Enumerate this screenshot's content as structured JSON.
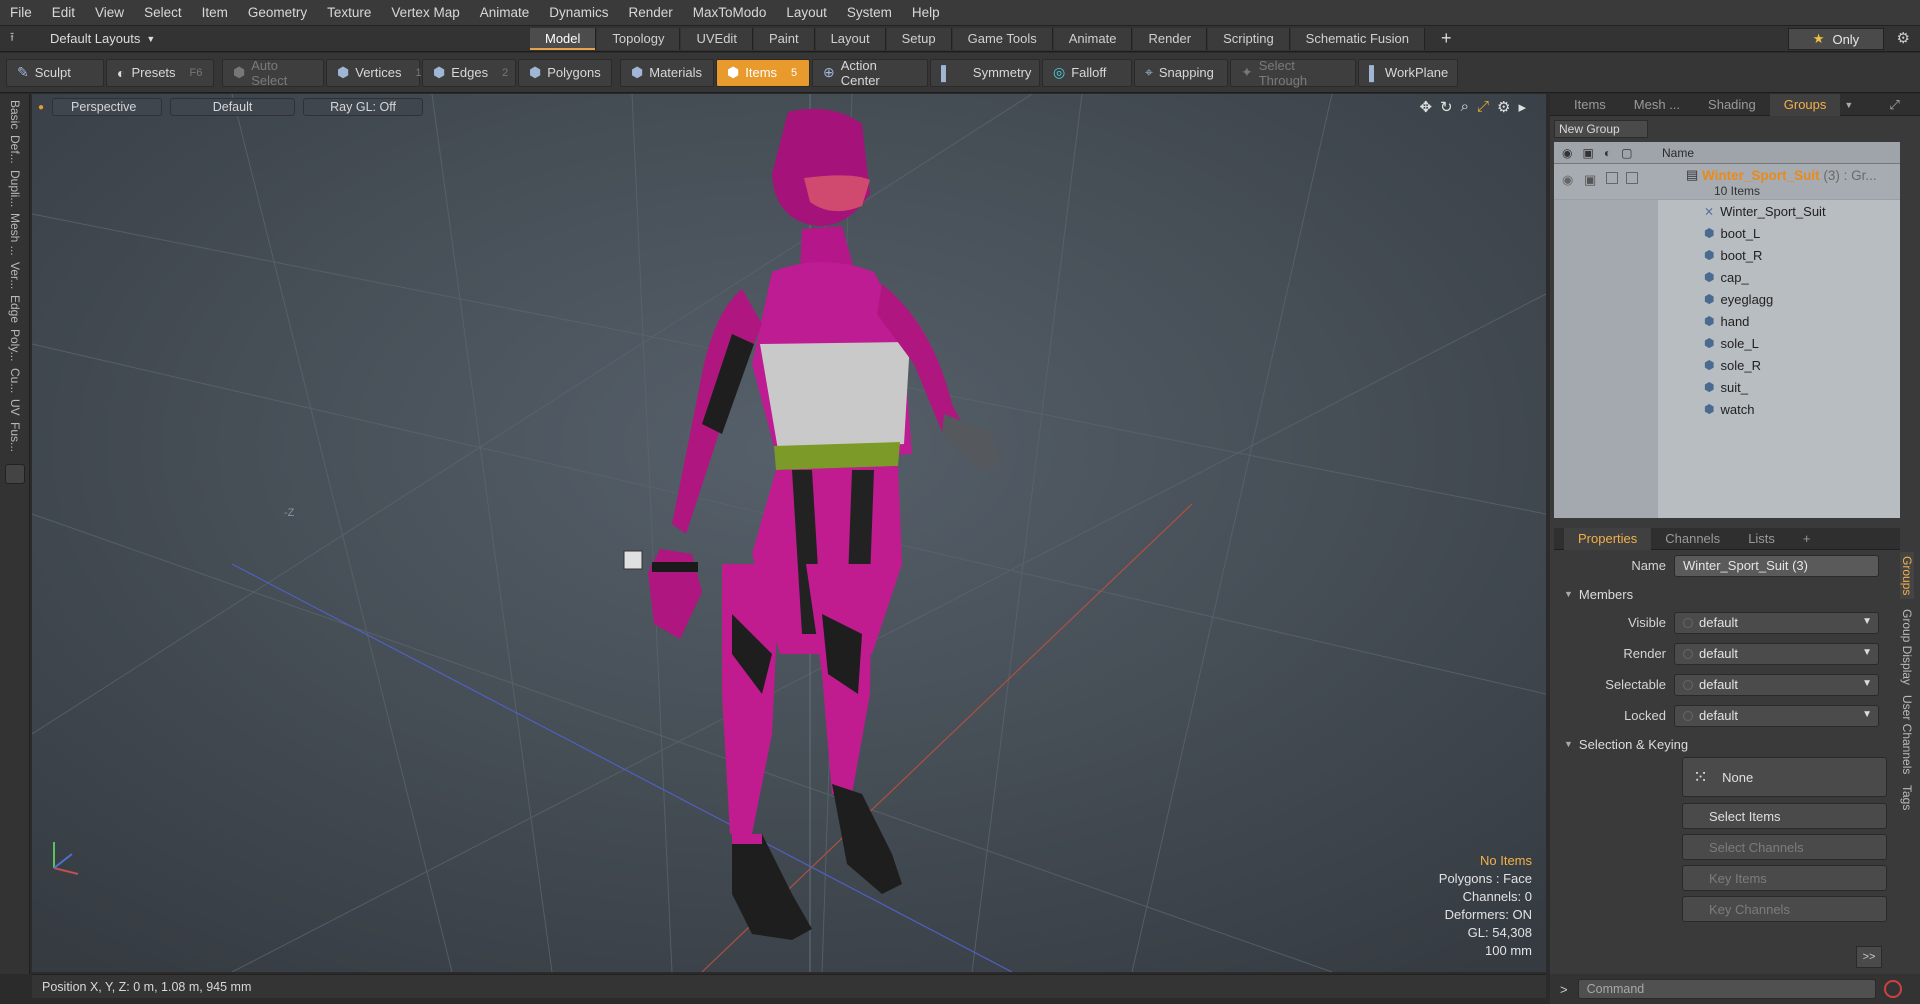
{
  "menu": [
    "File",
    "Edit",
    "View",
    "Select",
    "Item",
    "Geometry",
    "Texture",
    "Vertex Map",
    "Animate",
    "Dynamics",
    "Render",
    "MaxToModo",
    "Layout",
    "System",
    "Help"
  ],
  "layouts": {
    "label": "Default Layouts",
    "tabs": [
      "Model",
      "Topology",
      "UVEdit",
      "Paint",
      "Layout",
      "Setup",
      "Game Tools",
      "Animate",
      "Render",
      "Scripting",
      "Schematic Fusion"
    ],
    "active": "Model",
    "only": "Only"
  },
  "toolbar": {
    "sculpt": "Sculpt",
    "presets": "Presets",
    "presets_key": "F6",
    "auto_select": "Auto Select",
    "vertices": "Vertices",
    "vertices_num": "1",
    "edges": "Edges",
    "edges_num": "2",
    "polygons": "Polygons",
    "materials": "Materials",
    "items": "Items",
    "items_num": "5",
    "action_center": "Action Center",
    "symmetry": "Symmetry",
    "falloff": "Falloff",
    "snapping": "Snapping",
    "select_through": "Select Through",
    "workplane": "WorkPlane"
  },
  "left_tabs": [
    "Basic",
    "Def...",
    "Dupli...",
    "Mesh ...",
    "Ver...",
    "Edge",
    "Poly...",
    "Cu...",
    "UV",
    "Fus..."
  ],
  "viewport": {
    "view": "Perspective",
    "shading": "Default",
    "raygl": "Ray GL: Off",
    "info": {
      "items": "No Items",
      "polygons": "Polygons : Face",
      "channels": "Channels: 0",
      "deformers": "Deformers: ON",
      "gl": "GL: 54,308",
      "scale": "100 mm"
    },
    "axis_label": "-Z",
    "suit_color": "#b0157e"
  },
  "status": "Position X, Y, Z:   0 m, 1.08 m, 945 mm",
  "items_panel": {
    "tabs": [
      "Items",
      "Mesh ...",
      "Shading",
      "Groups"
    ],
    "active": "Groups",
    "new_group": "New Group",
    "name_col": "Name",
    "group_name": "Winter_Sport_Suit",
    "group_count": "(3) : Gr...",
    "group_sub": "10 Items",
    "items": [
      "Winter_Sport_Suit",
      "boot_L",
      "boot_R",
      "cap_",
      "eyeglagg",
      "hand",
      "sole_L",
      "sole_R",
      "suit_",
      "watch"
    ]
  },
  "properties": {
    "tabs": [
      "Properties",
      "Channels",
      "Lists",
      "+"
    ],
    "name_label": "Name",
    "name_value": "Winter_Sport_Suit (3)",
    "members": "Members",
    "visible_label": "Visible",
    "render_label": "Render",
    "selectable_label": "Selectable",
    "locked_label": "Locked",
    "default": "default",
    "sel_keying": "Selection & Keying",
    "none": "None",
    "select_items": "Select Items",
    "select_channels": "Select Channels",
    "key_items": "Key Items",
    "key_channels": "Key Channels",
    "more": ">>",
    "side_tabs": [
      "Groups",
      "Group Display",
      "User Channels",
      "Tags"
    ]
  },
  "command": {
    "placeholder": "Command"
  }
}
